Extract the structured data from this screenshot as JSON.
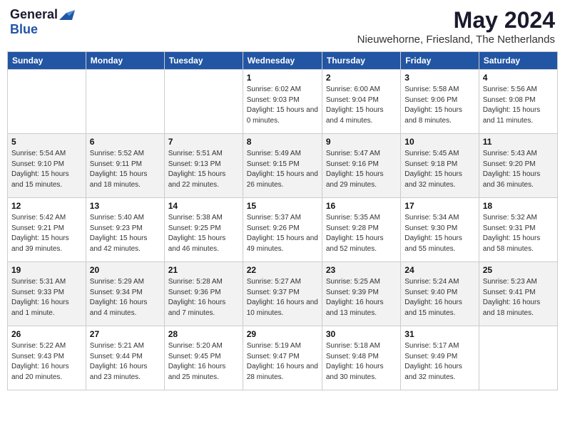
{
  "header": {
    "logo_general": "General",
    "logo_blue": "Blue",
    "month_year": "May 2024",
    "location": "Nieuwehorne, Friesland, The Netherlands"
  },
  "days_of_week": [
    "Sunday",
    "Monday",
    "Tuesday",
    "Wednesday",
    "Thursday",
    "Friday",
    "Saturday"
  ],
  "weeks": [
    [
      {
        "day": "",
        "sunrise": "",
        "sunset": "",
        "daylight": ""
      },
      {
        "day": "",
        "sunrise": "",
        "sunset": "",
        "daylight": ""
      },
      {
        "day": "",
        "sunrise": "",
        "sunset": "",
        "daylight": ""
      },
      {
        "day": "1",
        "sunrise": "Sunrise: 6:02 AM",
        "sunset": "Sunset: 9:03 PM",
        "daylight": "Daylight: 15 hours and 0 minutes."
      },
      {
        "day": "2",
        "sunrise": "Sunrise: 6:00 AM",
        "sunset": "Sunset: 9:04 PM",
        "daylight": "Daylight: 15 hours and 4 minutes."
      },
      {
        "day": "3",
        "sunrise": "Sunrise: 5:58 AM",
        "sunset": "Sunset: 9:06 PM",
        "daylight": "Daylight: 15 hours and 8 minutes."
      },
      {
        "day": "4",
        "sunrise": "Sunrise: 5:56 AM",
        "sunset": "Sunset: 9:08 PM",
        "daylight": "Daylight: 15 hours and 11 minutes."
      }
    ],
    [
      {
        "day": "5",
        "sunrise": "Sunrise: 5:54 AM",
        "sunset": "Sunset: 9:10 PM",
        "daylight": "Daylight: 15 hours and 15 minutes."
      },
      {
        "day": "6",
        "sunrise": "Sunrise: 5:52 AM",
        "sunset": "Sunset: 9:11 PM",
        "daylight": "Daylight: 15 hours and 18 minutes."
      },
      {
        "day": "7",
        "sunrise": "Sunrise: 5:51 AM",
        "sunset": "Sunset: 9:13 PM",
        "daylight": "Daylight: 15 hours and 22 minutes."
      },
      {
        "day": "8",
        "sunrise": "Sunrise: 5:49 AM",
        "sunset": "Sunset: 9:15 PM",
        "daylight": "Daylight: 15 hours and 26 minutes."
      },
      {
        "day": "9",
        "sunrise": "Sunrise: 5:47 AM",
        "sunset": "Sunset: 9:16 PM",
        "daylight": "Daylight: 15 hours and 29 minutes."
      },
      {
        "day": "10",
        "sunrise": "Sunrise: 5:45 AM",
        "sunset": "Sunset: 9:18 PM",
        "daylight": "Daylight: 15 hours and 32 minutes."
      },
      {
        "day": "11",
        "sunrise": "Sunrise: 5:43 AM",
        "sunset": "Sunset: 9:20 PM",
        "daylight": "Daylight: 15 hours and 36 minutes."
      }
    ],
    [
      {
        "day": "12",
        "sunrise": "Sunrise: 5:42 AM",
        "sunset": "Sunset: 9:21 PM",
        "daylight": "Daylight: 15 hours and 39 minutes."
      },
      {
        "day": "13",
        "sunrise": "Sunrise: 5:40 AM",
        "sunset": "Sunset: 9:23 PM",
        "daylight": "Daylight: 15 hours and 42 minutes."
      },
      {
        "day": "14",
        "sunrise": "Sunrise: 5:38 AM",
        "sunset": "Sunset: 9:25 PM",
        "daylight": "Daylight: 15 hours and 46 minutes."
      },
      {
        "day": "15",
        "sunrise": "Sunrise: 5:37 AM",
        "sunset": "Sunset: 9:26 PM",
        "daylight": "Daylight: 15 hours and 49 minutes."
      },
      {
        "day": "16",
        "sunrise": "Sunrise: 5:35 AM",
        "sunset": "Sunset: 9:28 PM",
        "daylight": "Daylight: 15 hours and 52 minutes."
      },
      {
        "day": "17",
        "sunrise": "Sunrise: 5:34 AM",
        "sunset": "Sunset: 9:30 PM",
        "daylight": "Daylight: 15 hours and 55 minutes."
      },
      {
        "day": "18",
        "sunrise": "Sunrise: 5:32 AM",
        "sunset": "Sunset: 9:31 PM",
        "daylight": "Daylight: 15 hours and 58 minutes."
      }
    ],
    [
      {
        "day": "19",
        "sunrise": "Sunrise: 5:31 AM",
        "sunset": "Sunset: 9:33 PM",
        "daylight": "Daylight: 16 hours and 1 minute."
      },
      {
        "day": "20",
        "sunrise": "Sunrise: 5:29 AM",
        "sunset": "Sunset: 9:34 PM",
        "daylight": "Daylight: 16 hours and 4 minutes."
      },
      {
        "day": "21",
        "sunrise": "Sunrise: 5:28 AM",
        "sunset": "Sunset: 9:36 PM",
        "daylight": "Daylight: 16 hours and 7 minutes."
      },
      {
        "day": "22",
        "sunrise": "Sunrise: 5:27 AM",
        "sunset": "Sunset: 9:37 PM",
        "daylight": "Daylight: 16 hours and 10 minutes."
      },
      {
        "day": "23",
        "sunrise": "Sunrise: 5:25 AM",
        "sunset": "Sunset: 9:39 PM",
        "daylight": "Daylight: 16 hours and 13 minutes."
      },
      {
        "day": "24",
        "sunrise": "Sunrise: 5:24 AM",
        "sunset": "Sunset: 9:40 PM",
        "daylight": "Daylight: 16 hours and 15 minutes."
      },
      {
        "day": "25",
        "sunrise": "Sunrise: 5:23 AM",
        "sunset": "Sunset: 9:41 PM",
        "daylight": "Daylight: 16 hours and 18 minutes."
      }
    ],
    [
      {
        "day": "26",
        "sunrise": "Sunrise: 5:22 AM",
        "sunset": "Sunset: 9:43 PM",
        "daylight": "Daylight: 16 hours and 20 minutes."
      },
      {
        "day": "27",
        "sunrise": "Sunrise: 5:21 AM",
        "sunset": "Sunset: 9:44 PM",
        "daylight": "Daylight: 16 hours and 23 minutes."
      },
      {
        "day": "28",
        "sunrise": "Sunrise: 5:20 AM",
        "sunset": "Sunset: 9:45 PM",
        "daylight": "Daylight: 16 hours and 25 minutes."
      },
      {
        "day": "29",
        "sunrise": "Sunrise: 5:19 AM",
        "sunset": "Sunset: 9:47 PM",
        "daylight": "Daylight: 16 hours and 28 minutes."
      },
      {
        "day": "30",
        "sunrise": "Sunrise: 5:18 AM",
        "sunset": "Sunset: 9:48 PM",
        "daylight": "Daylight: 16 hours and 30 minutes."
      },
      {
        "day": "31",
        "sunrise": "Sunrise: 5:17 AM",
        "sunset": "Sunset: 9:49 PM",
        "daylight": "Daylight: 16 hours and 32 minutes."
      },
      {
        "day": "",
        "sunrise": "",
        "sunset": "",
        "daylight": ""
      }
    ]
  ]
}
